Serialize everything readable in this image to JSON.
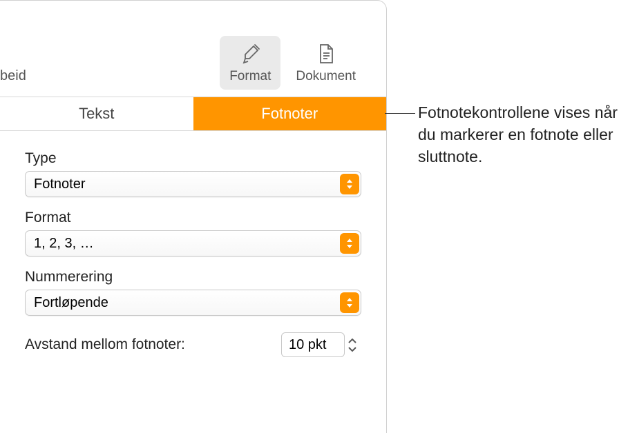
{
  "toolbar": {
    "left_label": "beid",
    "format_label": "Format",
    "document_label": "Dokument"
  },
  "tabs": {
    "text": "Tekst",
    "footnotes": "Fotnoter"
  },
  "fields": {
    "type_label": "Type",
    "type_value": "Fotnoter",
    "format_label": "Format",
    "format_value": "1, 2, 3, …",
    "numbering_label": "Nummerering",
    "numbering_value": "Fortløpende",
    "spacing_label": "Avstand mellom fotnoter:",
    "spacing_value": "10 pkt"
  },
  "annotation": "Fotnotekontrollene vises når du markerer en fotnote eller sluttnote."
}
